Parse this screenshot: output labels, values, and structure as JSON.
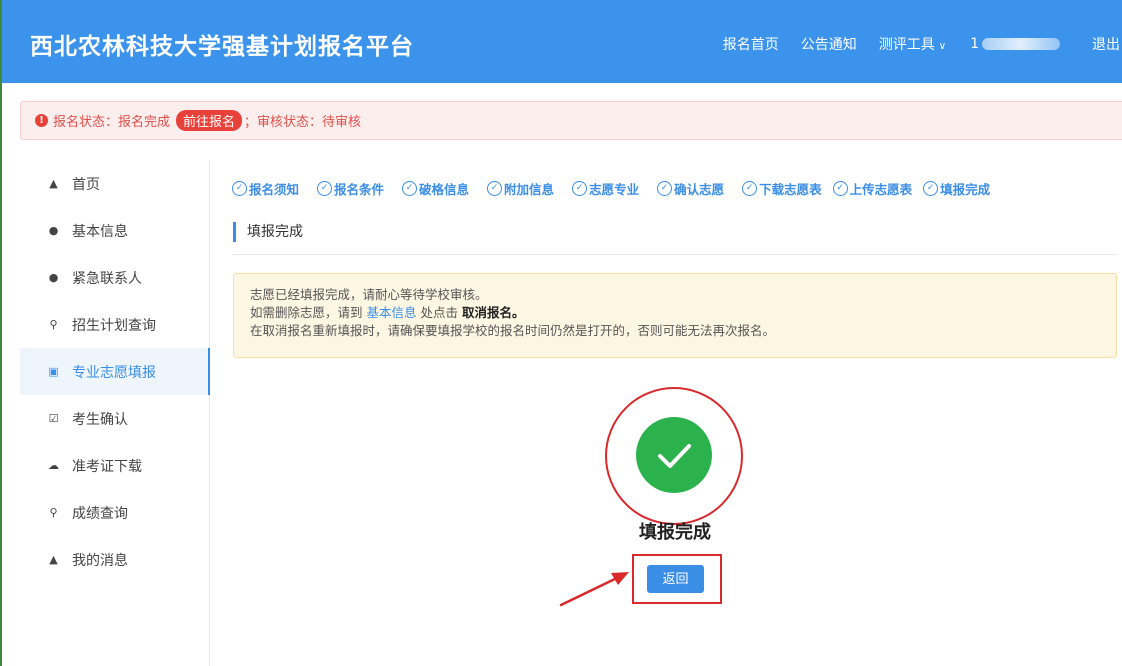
{
  "header": {
    "title": "西北农林科技大学强基计划报名平台",
    "nav": [
      "报名首页",
      "公告通知",
      "测评工具"
    ],
    "user_prefix": "1",
    "logout": "退出"
  },
  "status": {
    "label": "报名状态：报名完成",
    "button": "前往报名",
    "review": "；审核状态：待审核"
  },
  "sidebar": {
    "items": [
      {
        "icon": "home-icon",
        "label": "首页"
      },
      {
        "icon": "user-icon",
        "label": "基本信息"
      },
      {
        "icon": "user-icon",
        "label": "紧急联系人"
      },
      {
        "icon": "search-icon",
        "label": "招生计划查询"
      },
      {
        "icon": "form-icon",
        "label": "专业志愿填报"
      },
      {
        "icon": "checkbox-icon",
        "label": "考生确认"
      },
      {
        "icon": "cloud-icon",
        "label": "准考证下载"
      },
      {
        "icon": "search-icon",
        "label": "成绩查询"
      },
      {
        "icon": "bell-icon",
        "label": "我的消息"
      }
    ],
    "active_index": 4
  },
  "steps": [
    "报名须知",
    "报名条件",
    "破格信息",
    "附加信息",
    "志愿专业",
    "确认志愿",
    "下载志愿表",
    "上传志愿表",
    "填报完成"
  ],
  "section": {
    "title": "填报完成"
  },
  "notice": {
    "line1": "志愿已经填报完成，请耐心等待学校审核。",
    "line2_a": "如需删除志愿，请到 ",
    "line2_link": "基本信息",
    "line2_b": " 处点击 ",
    "line2_bold": "取消报名。",
    "line3": "在取消报名重新填报时，请确保要填报学校的报名时间仍然是打开的，否则可能无法再次报名。"
  },
  "result": {
    "text": "填报完成",
    "back_button": "返回"
  },
  "colors": {
    "primary": "#3b93ec",
    "success": "#2bb24c",
    "annotation": "#d9292b"
  }
}
